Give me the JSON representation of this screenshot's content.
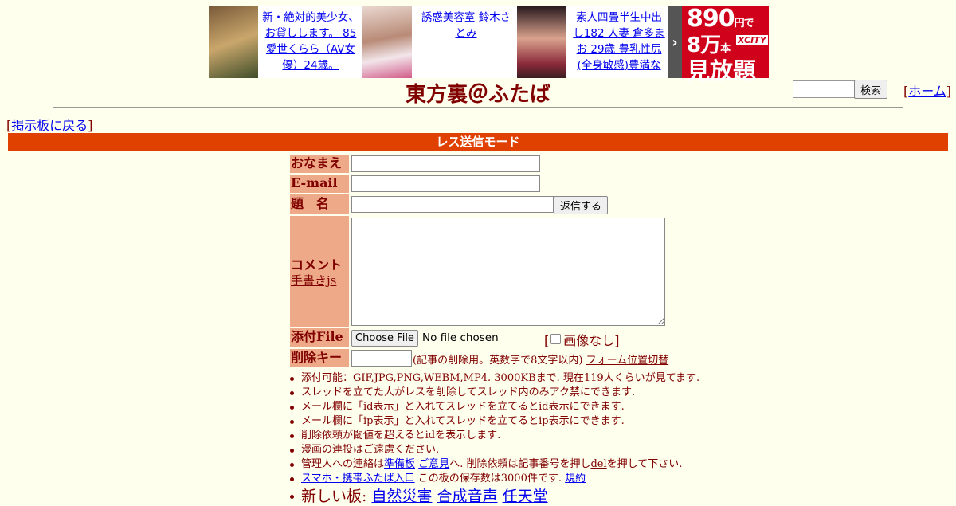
{
  "ads": [
    {
      "text": "新・絶対的美少女、お貸しします。 85 愛世くらら（AV女優）24歳。"
    },
    {
      "text": "誘惑美容室 鈴木さとみ"
    },
    {
      "text": "素人四畳半生中出し182 人妻 倉多まお 29歳 豊乳性尻(全身敏感)豊満な"
    }
  ],
  "promo": {
    "arrow": "›",
    "price": "890",
    "price_unit": "円で",
    "count": "8万",
    "count_unit": "本",
    "brand": "XCITY",
    "tagline": "見放題"
  },
  "header": {
    "title": "東方裏＠ふたば",
    "search_button": "検索",
    "home_link": "ホーム",
    "back_link": "掲示板に戻る"
  },
  "mode_bar": "レス送信モード",
  "form": {
    "name_label": "おなまえ",
    "email_label": "E-mail",
    "subject_label": "題　名",
    "reply_button": "返信する",
    "comment_label": "コメント",
    "handwrite_link": "手書きjs",
    "file_label": "添付File",
    "choose_file_button": "Choose File",
    "no_file_text": "No file chosen",
    "no_image_label": "画像なし",
    "delkey_label": "削除キー",
    "delkey_note": "(記事の削除用。英数字で8文字以内)",
    "form_toggle_link": "フォーム位置切替"
  },
  "notes": {
    "n1": "添付可能：GIF,JPG,PNG,WEBM,MP4. 3000KBまで. 現在119人くらいが見てます.",
    "n2": "スレッドを立てた人がレスを削除してスレッド内のみアク禁にできます.",
    "n3": "メール欄に「id表示」と入れてスレッドを立てるとid表示にできます.",
    "n4": "メール欄に「ip表示」と入れてスレッドを立てるとip表示にできます.",
    "n5": "削除依頼が閾値を超えるとidを表示します.",
    "n6": "漫画の連投はご遠慮ください.",
    "n7_a": "管理人への連絡は",
    "n7_link1": "準備板",
    "n7_link2": "ご意見",
    "n7_b": "へ. 削除依頼は記事番号を押し",
    "n7_link3": "del",
    "n7_c": "を押して下さい.",
    "n8_link1": "スマホ・携帯ふたば入口",
    "n8_text": "この板の保存数は3000件です.",
    "n8_link2": "規約",
    "n9_label": "新しい板:",
    "n9_links": [
      "自然災害",
      "合成音声",
      "任天堂"
    ]
  }
}
